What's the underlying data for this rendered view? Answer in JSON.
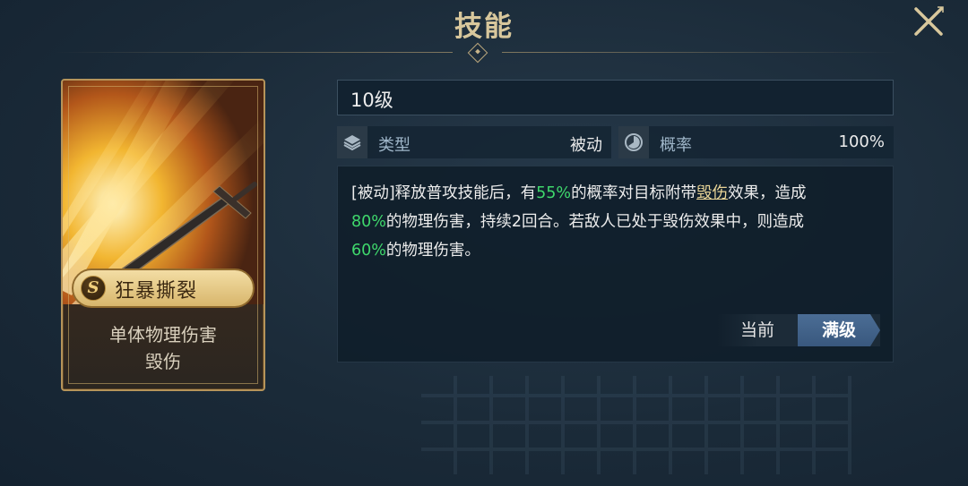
{
  "header": {
    "title": "技能"
  },
  "card": {
    "grade_badge": "S",
    "skill_name": "狂暴撕裂",
    "desc_line1": "单体物理伤害",
    "desc_line2": "毁伤"
  },
  "detail": {
    "level": "10级",
    "type_label": "类型",
    "type_value": "被动",
    "rate_label": "概率",
    "rate_value": "100%",
    "description": {
      "seg1": "[被动]释放普攻技能后，有",
      "pct1": "55%",
      "seg2": "的概率对目标附带",
      "keyword": "毁伤",
      "seg3": "效果，造成",
      "pct2": "80%",
      "seg4": "的物理伤害，持续2回合。若敌人已处于毁伤效果中，则造成",
      "pct3": "60%",
      "seg5": "的物理伤害。"
    }
  },
  "toggle": {
    "current_label": "当前",
    "max_label": "满级",
    "selected": "满级"
  },
  "colors": {
    "accent_gold": "#d8c79c",
    "highlight_green": "#3fd86c",
    "toggle_active": "#4b6d95"
  },
  "icons": {
    "close": "close-icon",
    "type": "layers-icon",
    "rate": "pie-chart-icon"
  }
}
